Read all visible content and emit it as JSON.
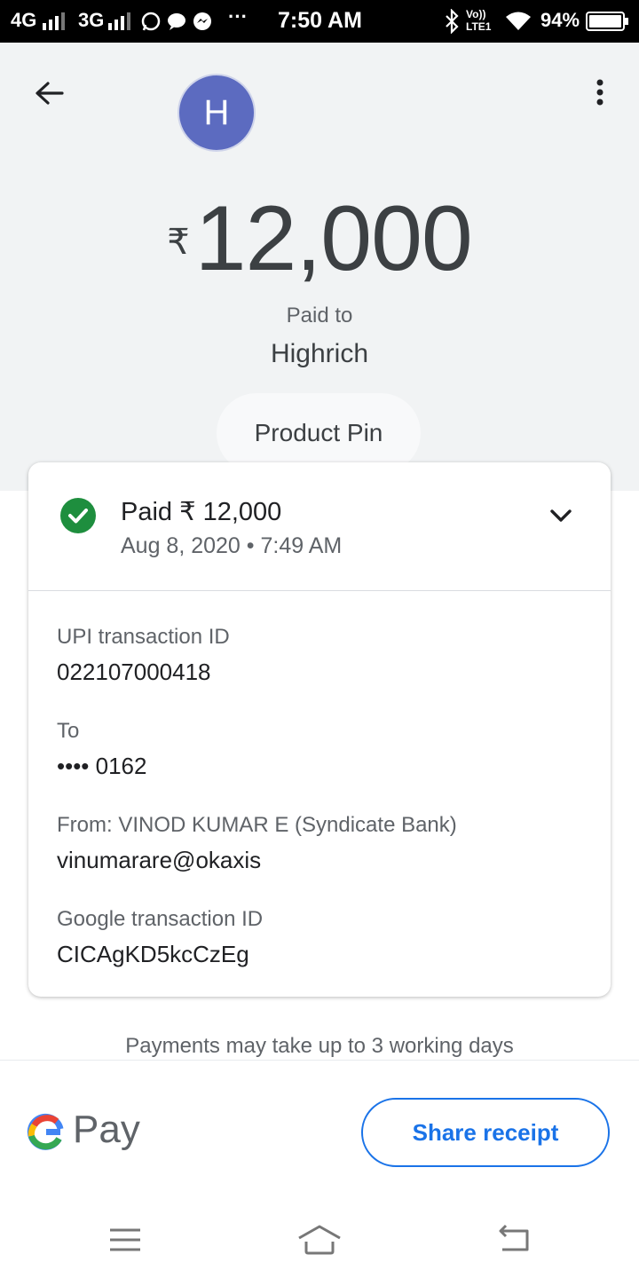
{
  "status_bar": {
    "network_1": "4G",
    "network_2": "3G",
    "more": "···",
    "time": "7:50 AM",
    "volte": "Vo)) LTE1",
    "battery": "94%"
  },
  "header": {
    "avatar_initial": "H",
    "currency_symbol": "₹",
    "amount": "12,000",
    "paid_to_label": "Paid to",
    "payee_name": "Highrich",
    "note_chip": "Product Pin"
  },
  "card": {
    "paid_line": "Paid ₹ 12,000",
    "date_line": "Aug 8, 2020 • 7:49 AM",
    "details": [
      {
        "label": "UPI transaction ID",
        "value": "022107000418"
      },
      {
        "label": "To",
        "value": "•••• 0162"
      },
      {
        "label": "From: VINOD KUMAR E (Syndicate Bank)",
        "value": "vinumarare@okaxis"
      },
      {
        "label": "Google transaction ID",
        "value": "CICAgKD5kcCzEg"
      }
    ]
  },
  "footer": {
    "note": "Payments may take up to 3 working days",
    "brand": "Pay",
    "share_button": "Share receipt"
  },
  "colors": {
    "accent": "#1a73e8",
    "success": "#1e8e3e",
    "avatar": "#5c6bc0",
    "header_bg": "#f1f3f4"
  }
}
